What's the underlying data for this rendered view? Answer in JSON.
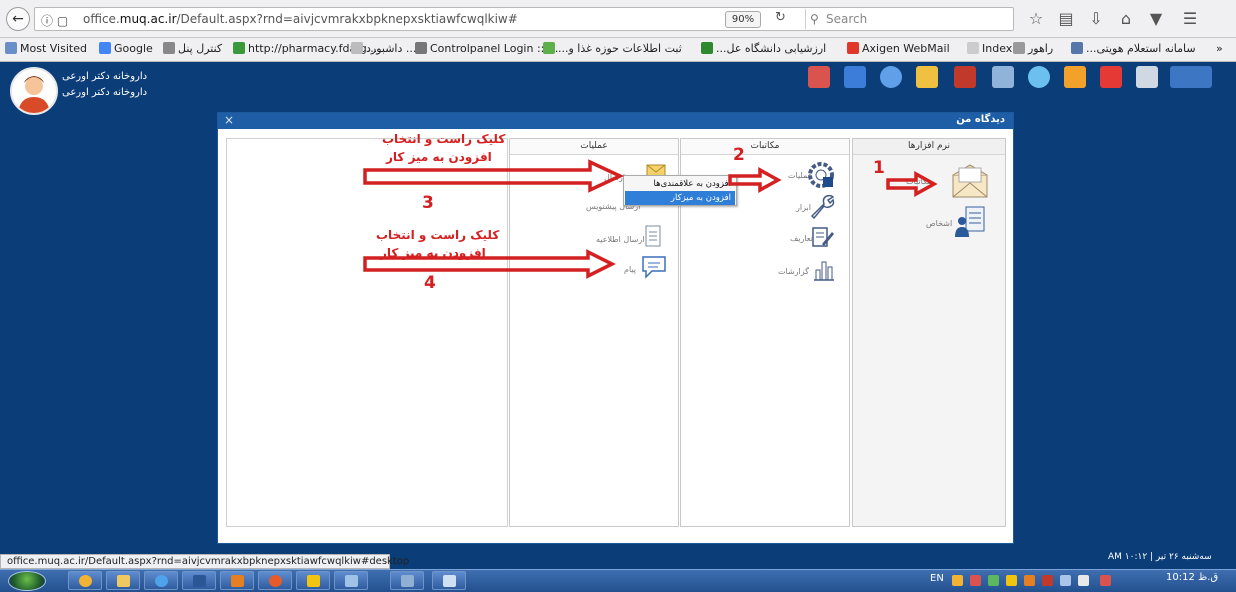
{
  "browser": {
    "info_icon": "info-icon",
    "url_prefix": "office.",
    "url_host": "muq.ac.ir",
    "url_path": "/Default.aspx?rnd=aivjcvmrakxbpknepxsktiawfcwqlkiw#",
    "zoom": "90%",
    "search_placeholder": "Search",
    "bookmarks": [
      "Most Visited",
      "Google",
      "کنترل پنل",
      "http://pharmacy.fda.g...",
      "داشبورد ...",
      "Controlpanel Login :: ...",
      "...ثبت اطلاعات حوزه غذا و",
      "...ارزشیابی دانشگاه عل",
      "Axigen WebMail",
      "Index",
      "راهور",
      "...سامانه استعلام هویتی",
      "»"
    ]
  },
  "header": {
    "user_line1": "داروخانه دکتر اورعی",
    "user_line2": "داروخانه دکتر اورعی"
  },
  "dialog": {
    "title": "دیدگاه من",
    "close": "×",
    "columns": {
      "software": {
        "title": "نرم افزارها",
        "items": [
          "مکاتبات",
          "اشخاص"
        ]
      },
      "correspondence": {
        "title": "مکاتبات",
        "items": [
          "عملیات",
          "ابزار",
          "تعاریف",
          "گزارشات"
        ]
      },
      "operations": {
        "title": "عملیات",
        "items": [
          "ارسال",
          "ارسال پیشنویس",
          "ارسال اطلاعیه",
          "پیام"
        ]
      }
    },
    "context_menu": {
      "add_favorites": "افزودن به علاقمندی‌ها",
      "add_desktop": "افزودن به میزکار"
    }
  },
  "annotations": {
    "n1": "1",
    "n2": "2",
    "n3": "3",
    "n4": "4",
    "instr1_l1": "کلیک راست و انتخاب",
    "instr1_l2": "افزودن به میز کار",
    "instr2_l1": "کلیک راست و انتخاب",
    "instr2_l2": "افزودن به میز کار"
  },
  "status_url": "office.muq.ac.ir/Default.aspx?rnd=aivjcvmrakxbpknepxsktiawfcwqlkiw#desktop",
  "datetime": "AM ۱۰:۱۲ | سه‌شنبه ۲۶ تیر",
  "taskbar": {
    "lang": "EN",
    "clock": "10:12 ق.ظ"
  },
  "colors": {
    "desktop": "#0b3d78",
    "dialog_header": "#1e5ea6",
    "annotation": "#d42020",
    "selected_menu": "#2f7fd8"
  }
}
